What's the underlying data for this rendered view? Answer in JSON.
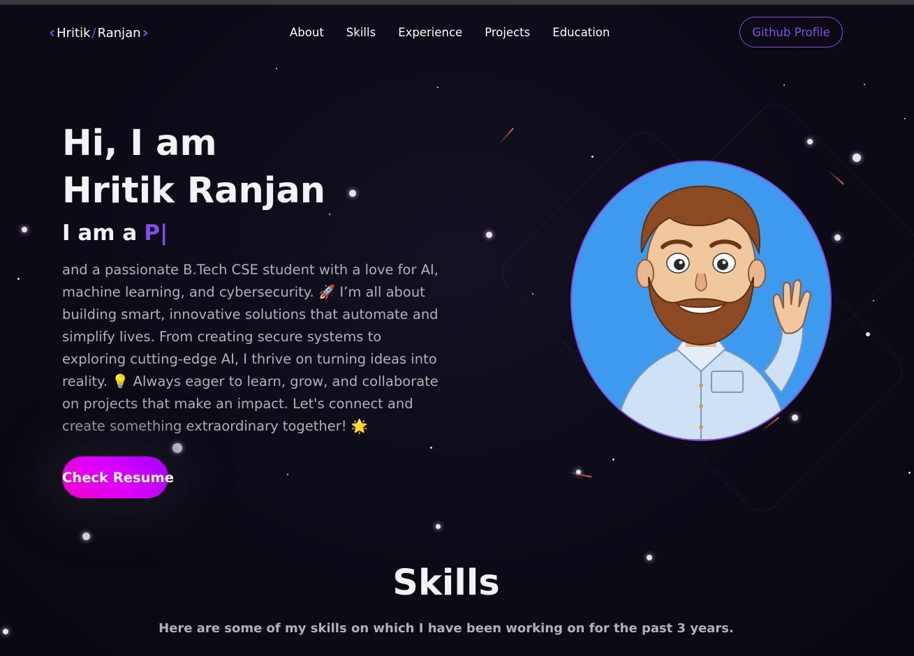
{
  "nav": {
    "logo_first": "Hritik",
    "logo_slash": "/",
    "logo_last": "Ranjan",
    "links": [
      {
        "label": "About"
      },
      {
        "label": "Skills"
      },
      {
        "label": "Experience"
      },
      {
        "label": "Projects"
      },
      {
        "label": "Education"
      }
    ],
    "github_button": "Github Profile"
  },
  "hero": {
    "greeting": "Hi, I am",
    "name": "Hritik Ranjan",
    "role_prefix": "I am a",
    "role_typed": "P|",
    "bio": "and a passionate B.Tech CSE student with a love for AI, machine learning, and cybersecurity. 🚀 I’m all about building smart, innovative solutions that automate and simplify lives. From creating secure systems to exploring cutting-edge AI, I thrive on turning ideas into reality. 💡 Always eager to learn, grow, and collaborate on projects that make an impact. Let's connect and create something extraordinary together! 🌟",
    "resume_button": "Check Resume"
  },
  "skills": {
    "title": "Skills",
    "description": "Here are some of my skills on which I have been working on for the past 3 years."
  },
  "colors": {
    "accent": "#854ce6",
    "background": "#0d0b17",
    "text_primary": "#f2f3f4",
    "text_secondary": "#b1b2b3",
    "avatar_bg": "#3e9aee"
  }
}
